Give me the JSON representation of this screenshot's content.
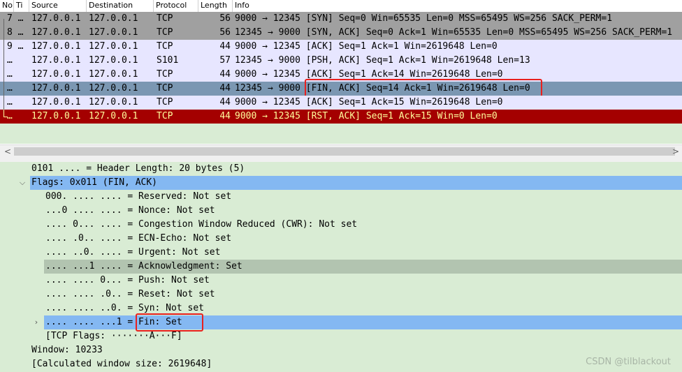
{
  "packet_list": {
    "columns": [
      "No",
      "Ti",
      "Source",
      "Destination",
      "Protocol",
      "Length",
      "Info"
    ],
    "rows": [
      {
        "no": "7 …",
        "src": "127.0.0.1",
        "dst": "127.0.0.1",
        "proto": "TCP",
        "len": "56",
        "info": "9000 → 12345 [SYN] Seq=0 Win=65535 Len=0 MSS=65495 WS=256 SACK_PERM=1"
      },
      {
        "no": "8 …",
        "src": "127.0.0.1",
        "dst": "127.0.0.1",
        "proto": "TCP",
        "len": "56",
        "info": "12345 → 9000 [SYN, ACK] Seq=0 Ack=1 Win=65535 Len=0 MSS=65495 WS=256 SACK_PERM=1"
      },
      {
        "no": "9 …",
        "src": "127.0.0.1",
        "dst": "127.0.0.1",
        "proto": "TCP",
        "len": "44",
        "info": "9000 → 12345 [ACK] Seq=1 Ack=1 Win=2619648 Len=0"
      },
      {
        "no": "…",
        "src": "127.0.0.1",
        "dst": "127.0.0.1",
        "proto": "S101",
        "len": "57",
        "info": "12345 → 9000 [PSH, ACK] Seq=1 Ack=1 Win=2619648 Len=13"
      },
      {
        "no": "…",
        "src": "127.0.0.1",
        "dst": "127.0.0.1",
        "proto": "TCP",
        "len": "44",
        "info": "9000 → 12345 [ACK] Seq=1 Ack=14 Win=2619648 Len=0"
      },
      {
        "no": "…",
        "src": "127.0.0.1",
        "dst": "127.0.0.1",
        "proto": "TCP",
        "len": "44",
        "info": "12345 → 9000 [FIN, ACK] Seq=14 Ack=1 Win=2619648 Len=0"
      },
      {
        "no": "…",
        "src": "127.0.0.1",
        "dst": "127.0.0.1",
        "proto": "TCP",
        "len": "44",
        "info": "9000 → 12345 [ACK] Seq=1 Ack=15 Win=2619648 Len=0"
      },
      {
        "no": "…",
        "src": "127.0.0.1",
        "dst": "127.0.0.1",
        "proto": "TCP",
        "len": "44",
        "info": "9000 → 12345 [RST, ACK] Seq=1 Ack=15 Win=0 Len=0"
      }
    ]
  },
  "scrollbar": {
    "left_arrow": "<",
    "right_arrow": ">"
  },
  "details": {
    "lines": [
      "0101 .... = Header Length: 20 bytes (5)",
      "Flags: 0x011 (FIN, ACK)",
      "000. .... .... = Reserved: Not set",
      "...0 .... .... = Nonce: Not set",
      ".... 0... .... = Congestion Window Reduced (CWR): Not set",
      ".... .0.. .... = ECN-Echo: Not set",
      ".... ..0. .... = Urgent: Not set",
      ".... ...1 .... = Acknowledgment: Set",
      ".... .... 0... = Push: Not set",
      ".... .... .0.. = Reset: Not set",
      ".... .... ..0. = Syn: Not set",
      ".... .... ...1 = Fin: Set",
      "[TCP Flags: ·······A···F]",
      "Window: 10233",
      "[Calculated window size: 2619648]"
    ]
  },
  "watermark": "CSDN @tilblackout",
  "colors": {
    "tcp_row_bg": "#e7e6ff",
    "syn_row_bg": "#a0a0a0",
    "selected_row_bg": "#7b97b2",
    "rst_row_bg": "#a40000",
    "rst_row_fg": "#fffc9c",
    "details_bg": "#d9ecd4",
    "details_highlight": "#84b8f2",
    "details_related": "#b2c4b0",
    "annotation_box": "#e8201e"
  },
  "icons": {
    "expanded": "chevron-down-icon",
    "collapsed": "chevron-right-icon"
  }
}
